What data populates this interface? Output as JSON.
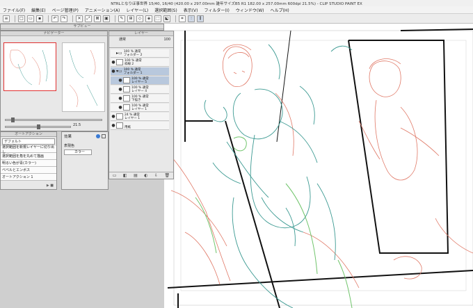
{
  "app": {
    "window_title": "NTRLとなりほ事世界 15/40, 16/40 (420.00 x 297.00mm 雑年サイズB5 R1 182.00 x 257.00mm 600dpi 21.5%) - CLIP STUDIO PAINT EX"
  },
  "menu": [
    "ファイル(F)",
    "編集(E)",
    "ページ管理(P)",
    "アニメーション(A)",
    "レイヤー(L)",
    "選択範囲(S)",
    "表示(V)",
    "フィルター(I)",
    "ウィンドウ(W)",
    "ヘルプ(H)"
  ],
  "toolbar_icons": [
    "menu-icon",
    "new-icon",
    "open-icon",
    "save-icon",
    "undo-icon",
    "redo-icon",
    "clear-icon",
    "transform-icon",
    "deselect-icon",
    "fill-icon",
    "pen-icon",
    "ruler-icon",
    "select-icon",
    "select-icon",
    "select-icon",
    "select-icon",
    "ruler-snap-icon",
    "snap-icon",
    "snap-icon"
  ],
  "navigator": {
    "title": "ナビゲーター",
    "zoom": "21.5",
    "rotate_labels": "0.0"
  },
  "subview": {
    "title": "サブビュー"
  },
  "autoaction": {
    "title": "オートアクション",
    "set_name": "デフォルト",
    "items": [
      "選択範囲を新規レイヤーに切り出し",
      "選択範囲を角を丸めて描画",
      "明るい色が青(カラー)",
      "ベベルとエンボス",
      "オートアクション 1"
    ]
  },
  "layer_panel": {
    "title": "レイヤー",
    "blend_mode": "通常",
    "opacity": "100",
    "rows": [
      {
        "label_line1": "100 % 通常",
        "label_line2": "フォルダー 2",
        "selected": false
      },
      {
        "label_line1": "100 % 通常",
        "label_line2": "枠線 2",
        "selected": false
      },
      {
        "label_line1": "100 % 通常",
        "label_line2": "フォルダー 1",
        "selected": true
      },
      {
        "label_line1": "100 % 通常",
        "label_line2": "レイヤー 5",
        "selected": true
      },
      {
        "label_line1": "100 % 通常",
        "label_line2": "レイヤー 4",
        "selected": false
      },
      {
        "label_line1": "100 % 通常",
        "label_line2": "下描き",
        "selected": false
      },
      {
        "label_line1": "100 % 通常",
        "label_line2": "レイヤー 1",
        "selected": false
      },
      {
        "label_line1": "24 % 通常",
        "label_line2": "レイヤー 1",
        "selected": false
      },
      {
        "label_line1": "",
        "label_line2": "用紙",
        "selected": false
      }
    ]
  },
  "effect_panel": {
    "title": "効果",
    "display_color_label": "表現色",
    "display_color_value": "カラー"
  },
  "colors": {
    "sketch_red": "#e07866",
    "sketch_teal": "#3c9a92",
    "sketch_green": "#6fc46a",
    "panel_border": "#111111",
    "selection_red": "#e03030"
  }
}
